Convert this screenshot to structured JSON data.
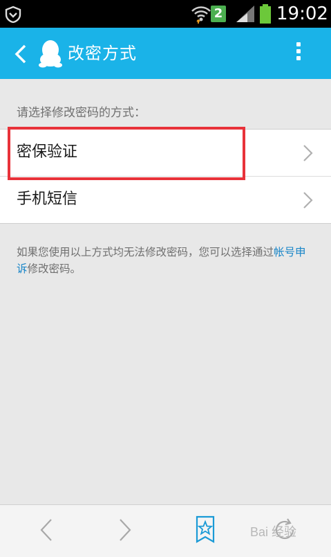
{
  "status_bar": {
    "sim_slot": "2",
    "time": "19:02"
  },
  "header": {
    "title": "改密方式"
  },
  "hint": "请选择修改密码的方式：",
  "options": [
    {
      "label": "密保验证"
    },
    {
      "label": "手机短信"
    }
  ],
  "footnote": {
    "text_before": "如果您使用以上方式均无法修改密码，您可以选择通过",
    "link": "帐号申诉",
    "text_after": "修改密码。"
  },
  "watermark": "Bai 经验",
  "colors": {
    "header_bg": "#1ab3e8",
    "highlight": "#e8323a",
    "link": "#1a86c8"
  }
}
